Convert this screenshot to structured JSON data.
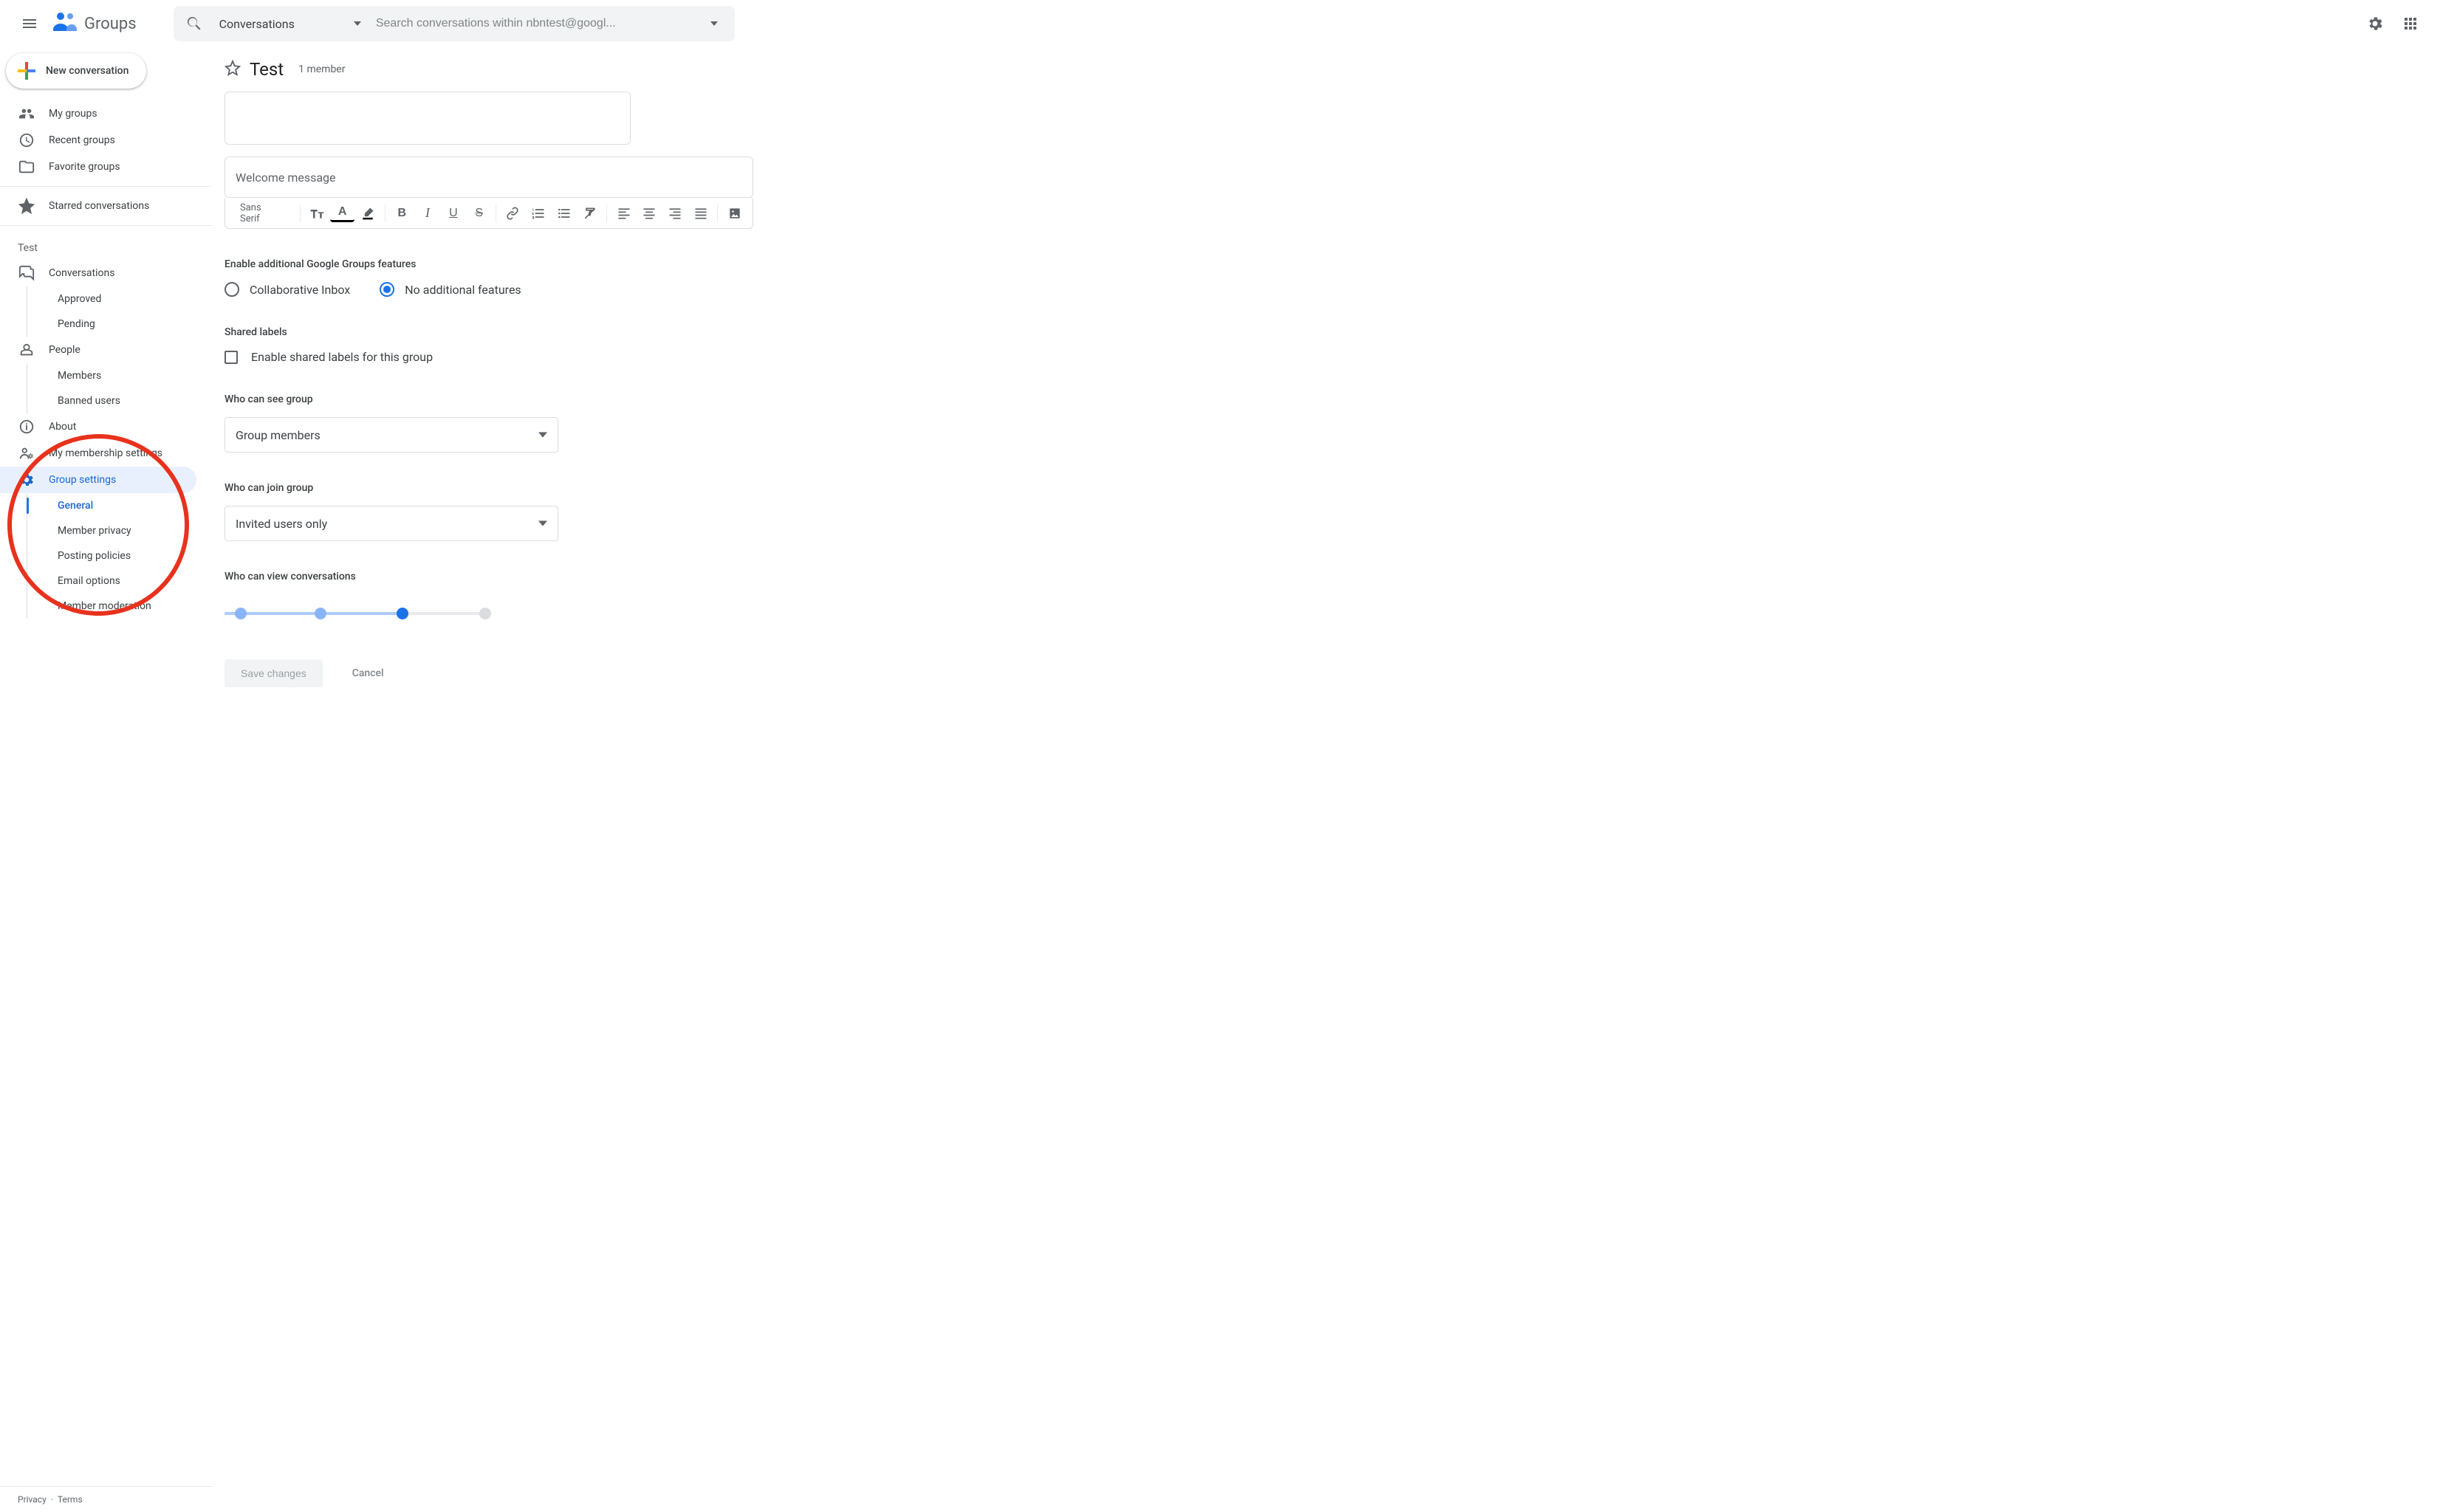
{
  "app": {
    "name": "Groups"
  },
  "search": {
    "scope": "Conversations",
    "placeholder": "Search conversations within nbntest@googl..."
  },
  "compose_button": "New conversation",
  "nav": {
    "primary": [
      {
        "label": "My groups",
        "icon": "groups"
      },
      {
        "label": "Recent groups",
        "icon": "clock"
      },
      {
        "label": "Favorite groups",
        "icon": "folder"
      }
    ],
    "starred": "Starred conversations",
    "section": "Test",
    "group": [
      {
        "label": "Conversations",
        "icon": "forum",
        "subs": [
          "Approved",
          "Pending"
        ]
      },
      {
        "label": "People",
        "icon": "people",
        "subs": [
          "Members",
          "Banned users"
        ]
      },
      {
        "label": "About",
        "icon": "info"
      },
      {
        "label": "My membership settings",
        "icon": "person-gear"
      },
      {
        "label": "Group settings",
        "icon": "gear",
        "active": true,
        "subs": [
          "General",
          "Member privacy",
          "Posting policies",
          "Email options",
          "Member moderation"
        ],
        "active_sub": 0
      }
    ]
  },
  "footer": {
    "privacy": "Privacy",
    "terms": "Terms"
  },
  "page": {
    "title": "Test",
    "members": "1 member",
    "welcome_placeholder": "Welcome message",
    "toolbar_font": "Sans Serif",
    "features_title": "Enable additional Google Groups features",
    "features_opts": [
      "Collaborative Inbox",
      "No additional features"
    ],
    "features_selected": 1,
    "shared_labels_title": "Shared labels",
    "shared_labels_check": "Enable shared labels for this group",
    "who_see_title": "Who can see group",
    "who_see_value": "Group members",
    "who_join_title": "Who can join group",
    "who_join_value": "Invited users only",
    "who_view_conv_title": "Who can view conversations",
    "save": "Save changes",
    "cancel": "Cancel"
  },
  "colors": {
    "blue": "#1a73e8"
  }
}
